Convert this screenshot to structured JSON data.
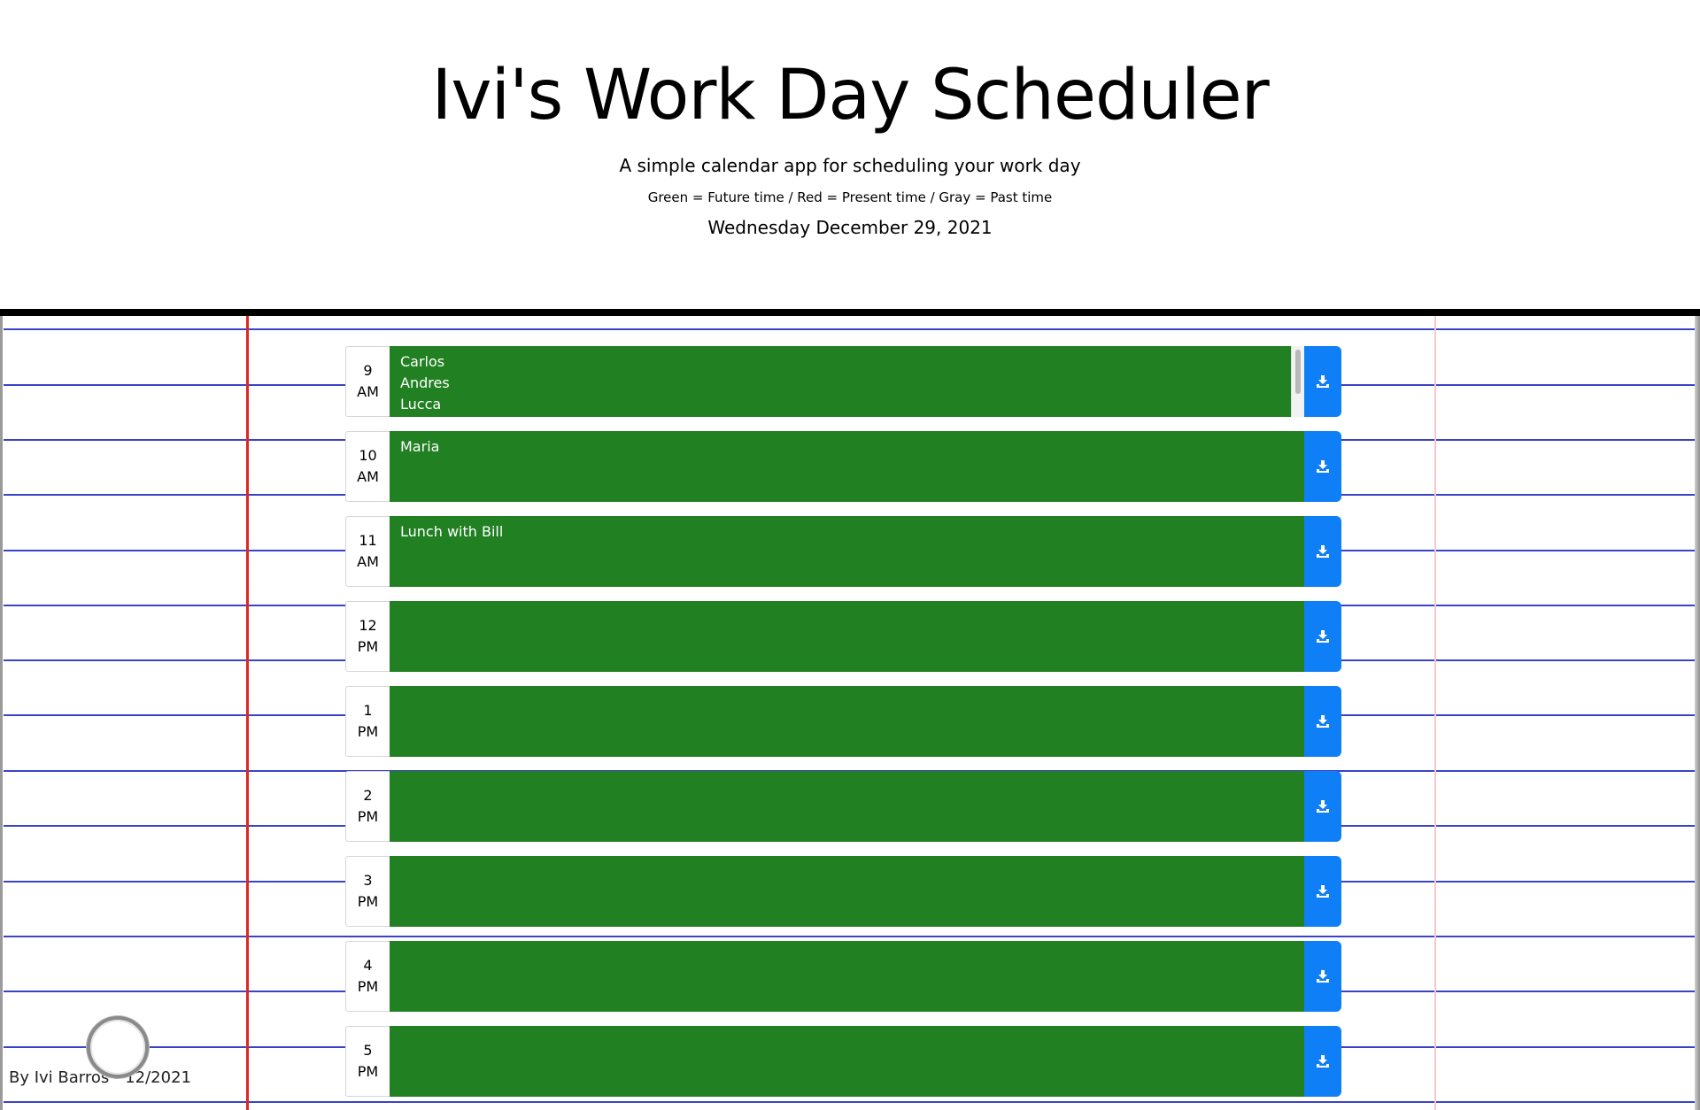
{
  "header": {
    "title": "Ivi's Work Day Scheduler",
    "subtitle": "A simple calendar app for scheduling your work day",
    "legend": "Green = Future time / Red = Present time / Gray = Past time",
    "current_date": "Wednesday December 29, 2021"
  },
  "schedule": [
    {
      "hour": "9",
      "period": "AM",
      "text": "Carlos\nAndres\nLucca",
      "status": "future"
    },
    {
      "hour": "10",
      "period": "AM",
      "text": "Maria",
      "status": "future"
    },
    {
      "hour": "11",
      "period": "AM",
      "text": "Lunch with Bill",
      "status": "future"
    },
    {
      "hour": "12",
      "period": "PM",
      "text": "",
      "status": "future"
    },
    {
      "hour": "1",
      "period": "PM",
      "text": "",
      "status": "future"
    },
    {
      "hour": "2",
      "period": "PM",
      "text": "",
      "status": "future"
    },
    {
      "hour": "3",
      "period": "PM",
      "text": "",
      "status": "future"
    },
    {
      "hour": "4",
      "period": "PM",
      "text": "",
      "status": "future"
    },
    {
      "hour": "5",
      "period": "PM",
      "text": "",
      "status": "future"
    }
  ],
  "save_icon": "save-download-icon",
  "colors": {
    "future": "#218022",
    "save_button": "#0f7ff8",
    "rule_line": "#3a43c8",
    "margin_line": "#e02525"
  },
  "footer": {
    "credit": "By Ivi Barros - 12/2021"
  }
}
